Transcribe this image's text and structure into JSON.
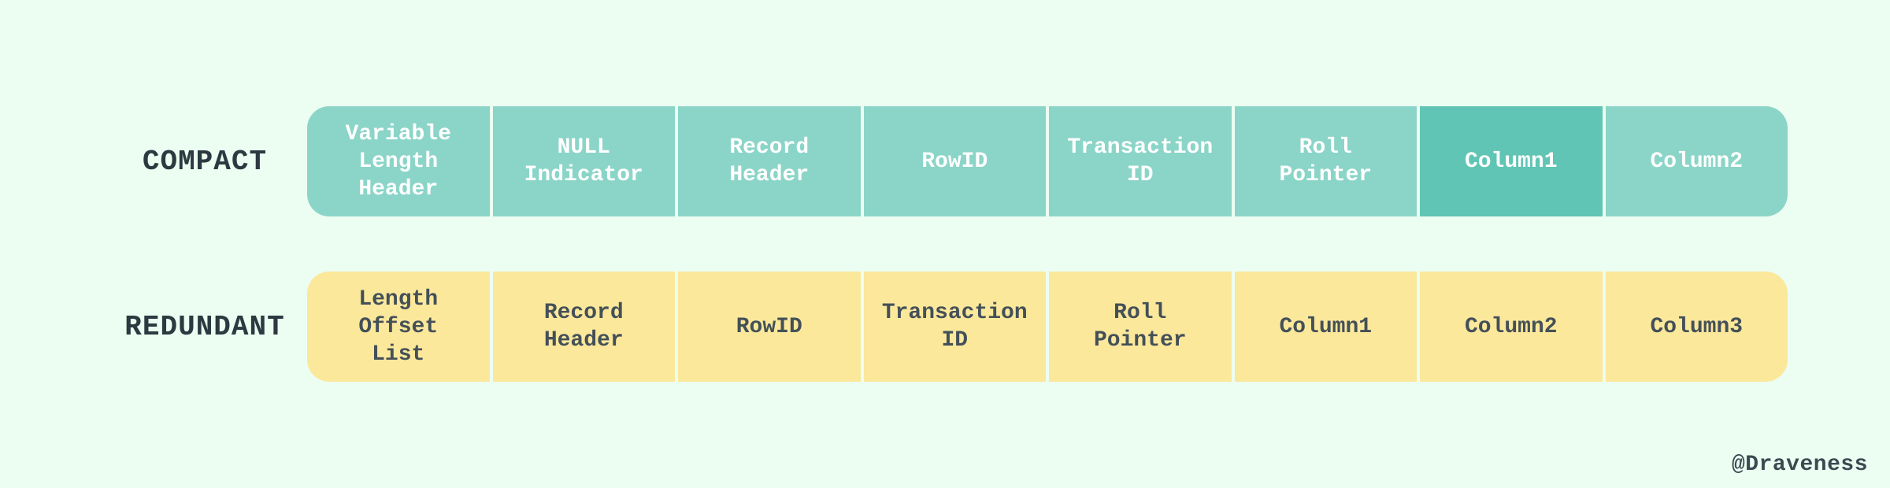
{
  "rows": [
    {
      "label": "COMPACT",
      "theme": "teal",
      "cells": [
        {
          "text": "Variable\nLength\nHeader",
          "highlight": false
        },
        {
          "text": "NULL\nIndicator",
          "highlight": false
        },
        {
          "text": "Record\nHeader",
          "highlight": false
        },
        {
          "text": "RowID",
          "highlight": false
        },
        {
          "text": "Transaction\nID",
          "highlight": false
        },
        {
          "text": "Roll\nPointer",
          "highlight": false
        },
        {
          "text": "Column1",
          "highlight": true
        },
        {
          "text": "Column2",
          "highlight": false
        }
      ]
    },
    {
      "label": "REDUNDANT",
      "theme": "yellow",
      "cells": [
        {
          "text": "Length\nOffset\nList",
          "highlight": false
        },
        {
          "text": "Record\nHeader",
          "highlight": false
        },
        {
          "text": "RowID",
          "highlight": false
        },
        {
          "text": "Transaction\nID",
          "highlight": false
        },
        {
          "text": "Roll\nPointer",
          "highlight": false
        },
        {
          "text": "Column1",
          "highlight": false
        },
        {
          "text": "Column2",
          "highlight": false
        },
        {
          "text": "Column3",
          "highlight": false
        }
      ]
    }
  ],
  "attribution": "@Draveness"
}
